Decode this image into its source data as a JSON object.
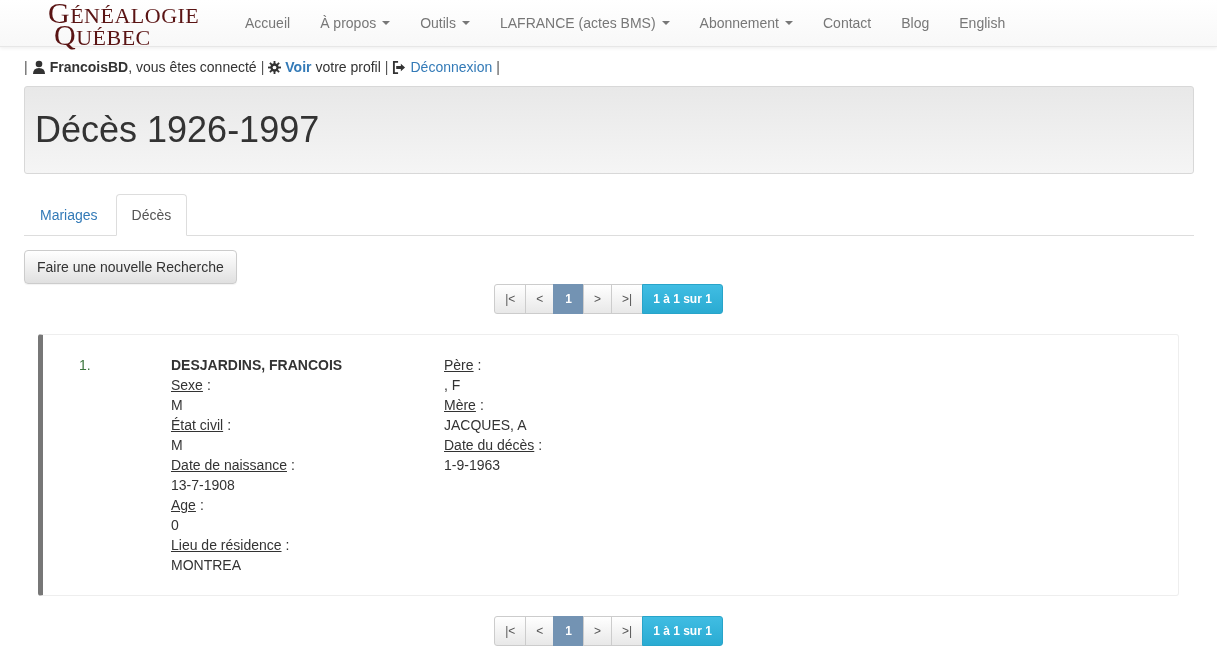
{
  "logo": {
    "line1": "GÉNÉALOGIE",
    "line2": "QUÉBEC"
  },
  "nav": [
    {
      "label": "Accueil",
      "dropdown": false
    },
    {
      "label": "À propos",
      "dropdown": true
    },
    {
      "label": "Outils",
      "dropdown": true
    },
    {
      "label": "LAFRANCE (actes BMS)",
      "dropdown": true
    },
    {
      "label": "Abonnement",
      "dropdown": true
    },
    {
      "label": "Contact",
      "dropdown": false
    },
    {
      "label": "Blog",
      "dropdown": false
    },
    {
      "label": "English",
      "dropdown": false
    }
  ],
  "user_bar": [
    {
      "kind": "sep",
      "text": "|"
    },
    {
      "kind": "user",
      "text": "FrancoisBD"
    },
    {
      "kind": "text",
      "text": ", vous êtes connecté"
    },
    {
      "kind": "sep",
      "text": "|"
    },
    {
      "kind": "profile",
      "bold": "Voir",
      "text": "votre profil"
    },
    {
      "kind": "sep",
      "text": "|"
    },
    {
      "kind": "logout",
      "text": "Déconnexion"
    },
    {
      "kind": "sep",
      "text": "|"
    }
  ],
  "title": "Décès 1926-1997",
  "tabs": [
    {
      "label": "Mariages",
      "selected": false
    },
    {
      "label": "Décès",
      "selected": true
    }
  ],
  "new_search_button": "Faire une nouvelle Recherche",
  "pagination_top": [
    {
      "kind": "first",
      "label": "|<"
    },
    {
      "kind": "prev",
      "label": "<"
    },
    {
      "kind": "page",
      "label": "1",
      "selected": true
    },
    {
      "kind": "next",
      "label": ">"
    },
    {
      "kind": "last",
      "label": ">|"
    },
    {
      "kind": "summary",
      "label": "1 à 1 sur 1"
    }
  ],
  "record": {
    "number": "1.",
    "label_suffix": ":",
    "column_1": [
      {
        "kind": "name",
        "value": "DESJARDINS, FRANCOIS"
      },
      {
        "kind": "field",
        "label": "Sexe",
        "value": "M"
      },
      {
        "kind": "field",
        "label": "État civil",
        "value": "M"
      },
      {
        "kind": "field",
        "label": "Date de naissance",
        "value": "13-7-1908"
      },
      {
        "kind": "field",
        "label": "Age",
        "value": "0"
      },
      {
        "kind": "field",
        "label": "Lieu de résidence",
        "value": "MONTREA"
      }
    ],
    "column_2": [
      {
        "kind": "field",
        "label": "Père",
        "value": ", F"
      },
      {
        "kind": "field",
        "label": "Mère",
        "value": "JACQUES, A"
      },
      {
        "kind": "field",
        "label": "Date du décès",
        "value": "1-9-1963"
      }
    ]
  },
  "pagination_bottom": [
    {
      "kind": "first",
      "label": "|<"
    },
    {
      "kind": "prev",
      "label": "<"
    },
    {
      "kind": "page",
      "label": "1",
      "selected": true
    },
    {
      "kind": "next",
      "label": ">"
    },
    {
      "kind": "last",
      "label": ">|"
    },
    {
      "kind": "summary",
      "label": "1 à 1 sur 1"
    }
  ]
}
